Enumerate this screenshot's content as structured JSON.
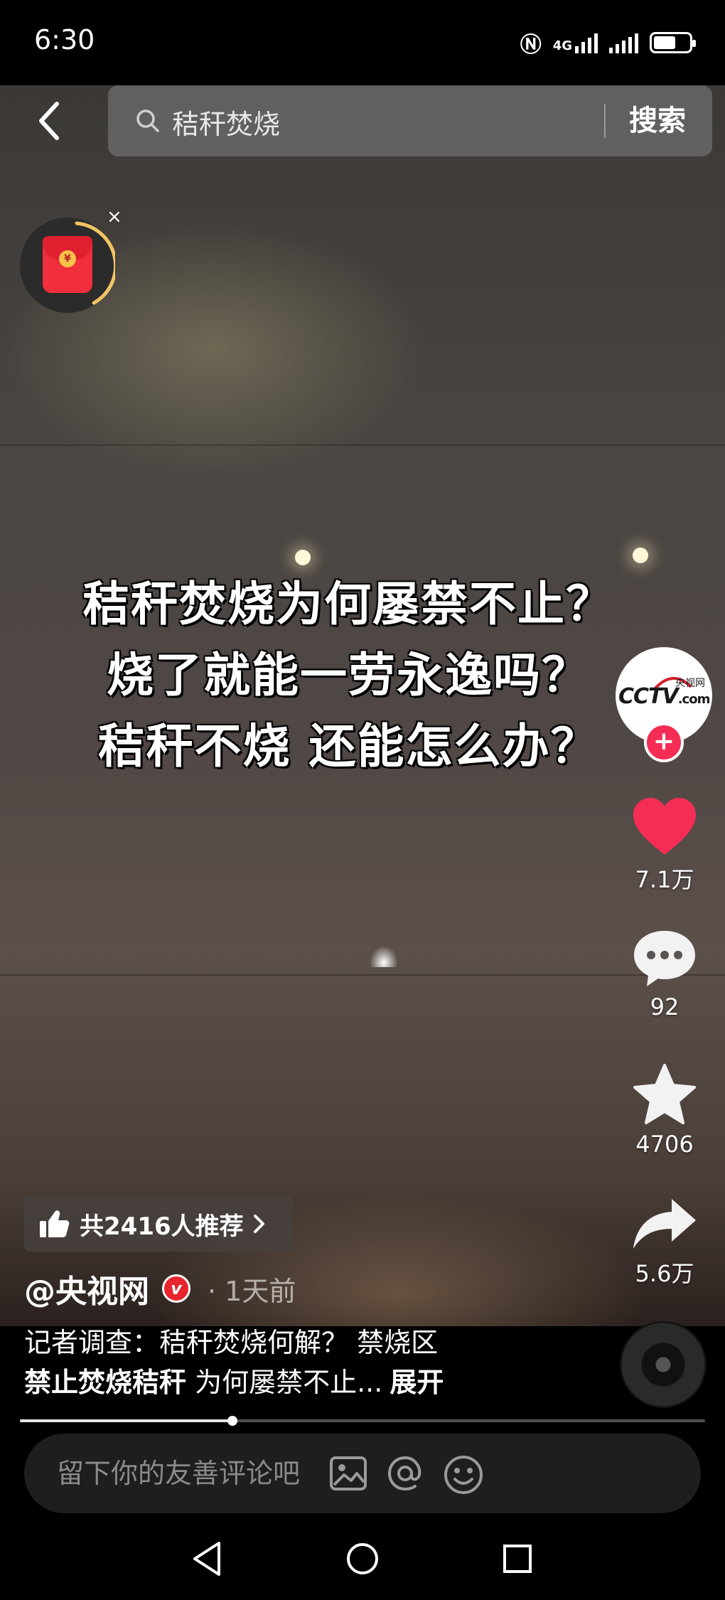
{
  "status_bar": {
    "time": "6:30",
    "network_label": "4G",
    "battery_level": 0.55
  },
  "search": {
    "query": "秸秆焚烧",
    "button_label": "搜索"
  },
  "red_packet": {
    "coin_symbol": "¥",
    "close_label": "×"
  },
  "video": {
    "overlay_lines": [
      "秸秆焚烧为何屡禁不止？",
      "烧了就能一劳永逸吗？",
      "秸秆不烧 还能怎么办？"
    ],
    "progress": 0.31
  },
  "account": {
    "logo_text": "CCTV",
    "logo_suffix": ".com",
    "logo_cn": "央视网",
    "follow_label": "+"
  },
  "actions": {
    "likes": "7.1万",
    "comments": "92",
    "favorites": "4706",
    "shares": "5.6万"
  },
  "recommend": {
    "label": "共2416人推荐"
  },
  "author": {
    "name": "@央视网",
    "verified_mark": "v",
    "time": "· 1天前"
  },
  "caption": {
    "line1": "记者调查：秸秆焚烧何解？ 禁烧区",
    "line2_bold": "禁止焚烧秸秆",
    "line2_rest": " 为何屡禁不止...",
    "expand_label": "展开"
  },
  "comment_bar": {
    "placeholder": "留下你的友善评论吧"
  },
  "icons": {
    "like_color": "#f52d55",
    "brand_red": "#e8242d"
  }
}
